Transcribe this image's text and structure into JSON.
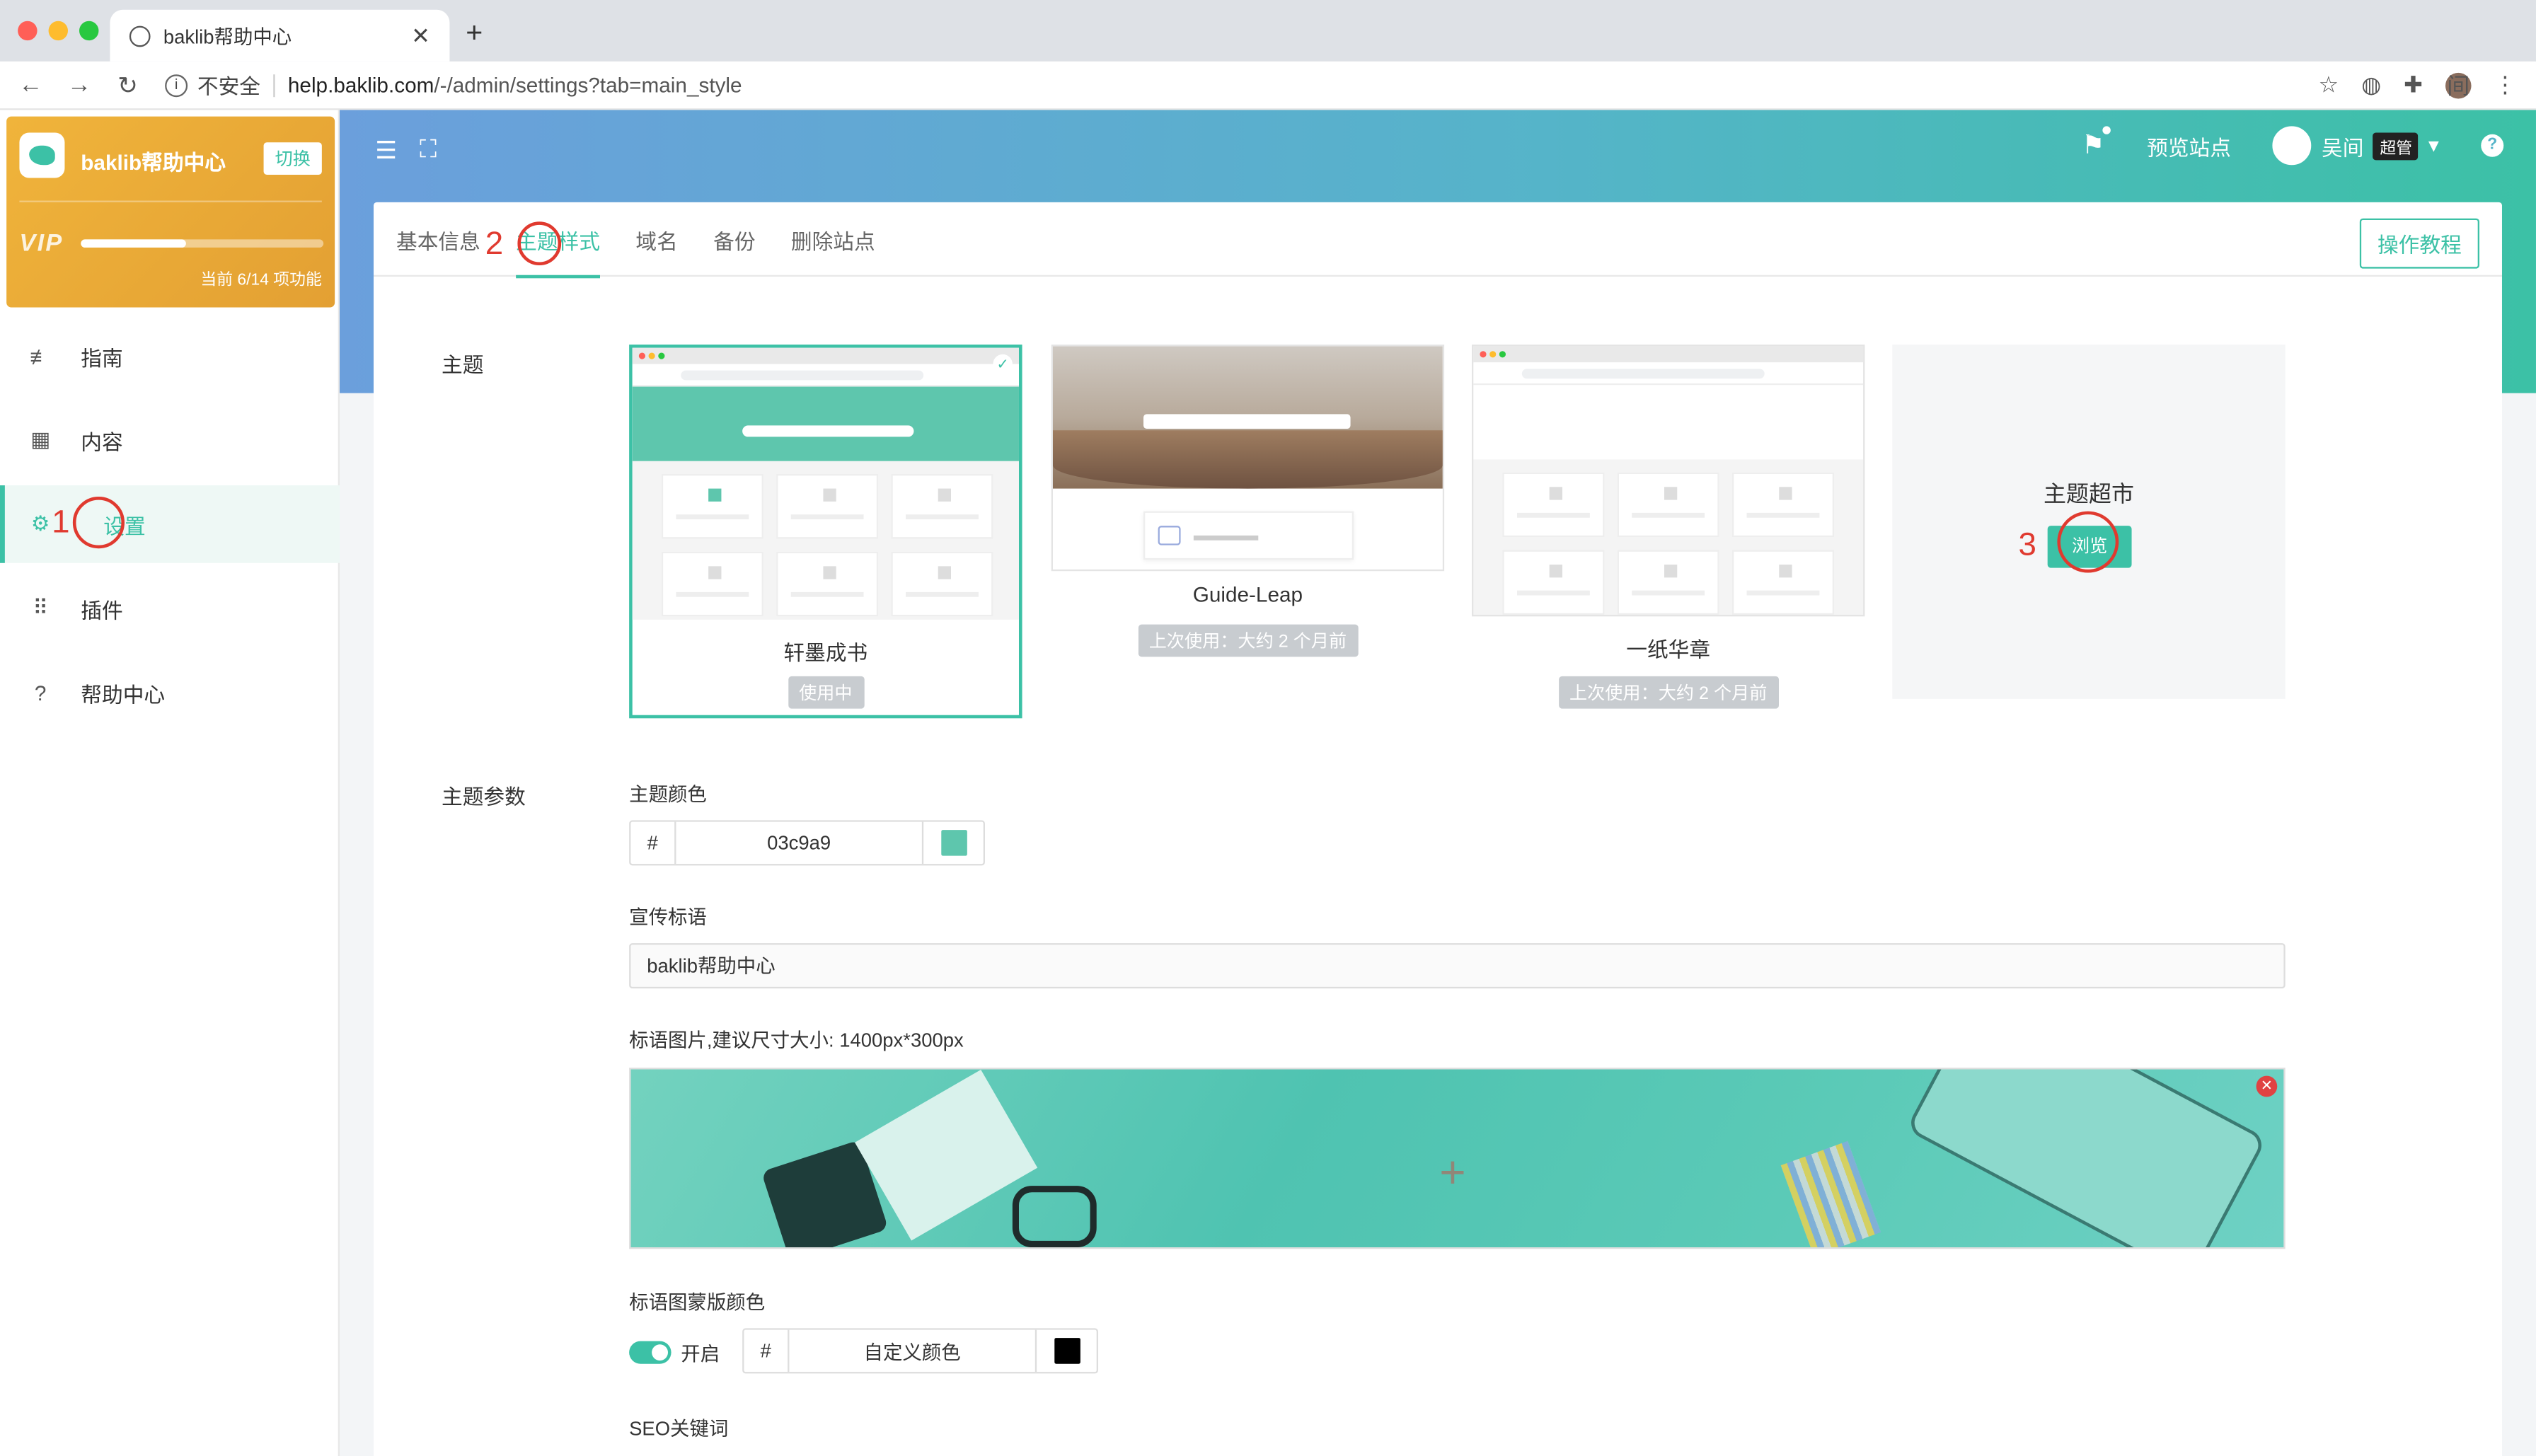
{
  "browser": {
    "tab_title": "baklib帮助中心",
    "tab_close": "✕",
    "new_tab": "+",
    "back": "←",
    "forward": "→",
    "reload": "↻",
    "info_glyph": "i",
    "insecure_label": "不安全",
    "url_host": "help.baklib.com",
    "url_path": "/-/admin/settings?tab=main_style",
    "bookmark": "☆",
    "ext_globe": "◍",
    "ext_puzzle": "✚",
    "avatar_text": "间",
    "menu": "⋮"
  },
  "header": {
    "list_icon": "☰",
    "fullscreen_icon": "⛶",
    "bell": "🔔",
    "preview_label": "预览站点",
    "user_name": "吴间",
    "user_role": "超管",
    "user_caret": "▾",
    "help_glyph": "?"
  },
  "site_card": {
    "name": "baklib帮助中心",
    "switch_label": "切换",
    "vip_mark": "VIP",
    "usage_text": "当前 6/14 项功能",
    "usage_progress": 0.43
  },
  "sidebar": {
    "items": [
      {
        "label": "指南",
        "icon": "≢"
      },
      {
        "label": "内容",
        "icon": "▦"
      },
      {
        "label": "设置",
        "icon": "⚙"
      },
      {
        "label": "插件",
        "icon": "⠿"
      },
      {
        "label": "帮助中心",
        "icon": "?"
      }
    ]
  },
  "annotations": {
    "n1": "1",
    "n2": "2",
    "n3": "3"
  },
  "tabs": [
    "基本信息",
    "主题样式",
    "域名",
    "备份",
    "删除站点"
  ],
  "tutorial_button": "操作教程",
  "theme_section": {
    "label": "主题",
    "themes": [
      {
        "name": "轩墨成书",
        "badge": "使用中",
        "check": "✓"
      },
      {
        "name": "Guide-Leap",
        "badge": "上次使用：大约 2 个月前"
      },
      {
        "name": "一纸华章",
        "badge": "上次使用：大约 2 个月前"
      }
    ],
    "market_title": "主题超市",
    "browse_label": "浏览"
  },
  "params": {
    "label": "主题参数",
    "color_label": "主题颜色",
    "hash": "#",
    "color_value": "03c9a9",
    "color_hex": "#5ec6ad",
    "slogan_label": "宣传标语",
    "slogan_value": "baklib帮助中心",
    "banner_label": "标语图片,建议尺寸大小: 1400px*300px",
    "banner_delete": "✕",
    "banner_crosshair": "+",
    "overlay_label": "标语图蒙版颜色",
    "overlay_toggle_label": "开启",
    "overlay_color_value": "自定义颜色",
    "overlay_color_hex": "#000000",
    "seo_label": "SEO关键词"
  },
  "colors": {
    "accent": "#3cc1a6",
    "annotation_red": "#e03a2f"
  }
}
